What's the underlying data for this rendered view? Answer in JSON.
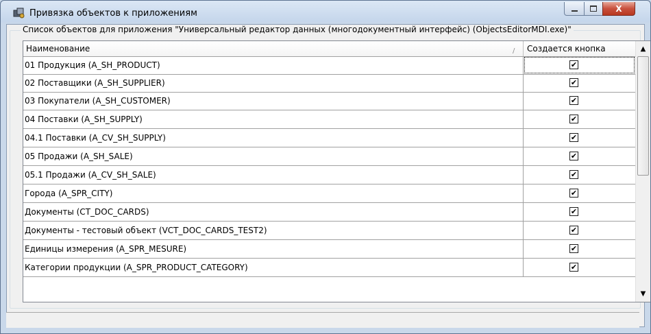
{
  "window": {
    "title": "Привязка объектов к приложениям",
    "controls": {
      "minimize": "–",
      "maximize": "□",
      "close": "X"
    }
  },
  "group": {
    "label": "Список объектов для приложения \"Универсальный редактор данных (многодокументный интерфейс) (ObjectsEditorMDI.exe)\""
  },
  "grid": {
    "columns": {
      "name": "Наименование",
      "sort_indicator": "/",
      "button": "Создается кнопка"
    },
    "rows": [
      {
        "name": "01 Продукция (A_SH_PRODUCT)",
        "checked": "✔"
      },
      {
        "name": "02 Поставщики (A_SH_SUPPLIER)",
        "checked": "✔"
      },
      {
        "name": "03 Покупатели (A_SH_CUSTOMER)",
        "checked": "✔"
      },
      {
        "name": "04 Поставки (A_SH_SUPPLY)",
        "checked": "✔"
      },
      {
        "name": "04.1 Поставки (A_CV_SH_SUPPLY)",
        "checked": "✔"
      },
      {
        "name": "05 Продажи (A_SH_SALE)",
        "checked": "✔"
      },
      {
        "name": "05.1 Продажи (A_CV_SH_SALE)",
        "checked": "✔"
      },
      {
        "name": "Города (A_SPR_CITY)",
        "checked": "✔"
      },
      {
        "name": "Документы (CT_DOC_CARDS)",
        "checked": "✔"
      },
      {
        "name": "Документы - тестовый объект (VCT_DOC_CARDS_TEST2)",
        "checked": "✔"
      },
      {
        "name": "Единицы измерения (A_SPR_MESURE)",
        "checked": "✔"
      },
      {
        "name": "Категории продукции (A_SPR_PRODUCT_CATEGORY)",
        "checked": "✔"
      }
    ],
    "scrollbar": {
      "up": "▲",
      "down": "▼"
    }
  }
}
